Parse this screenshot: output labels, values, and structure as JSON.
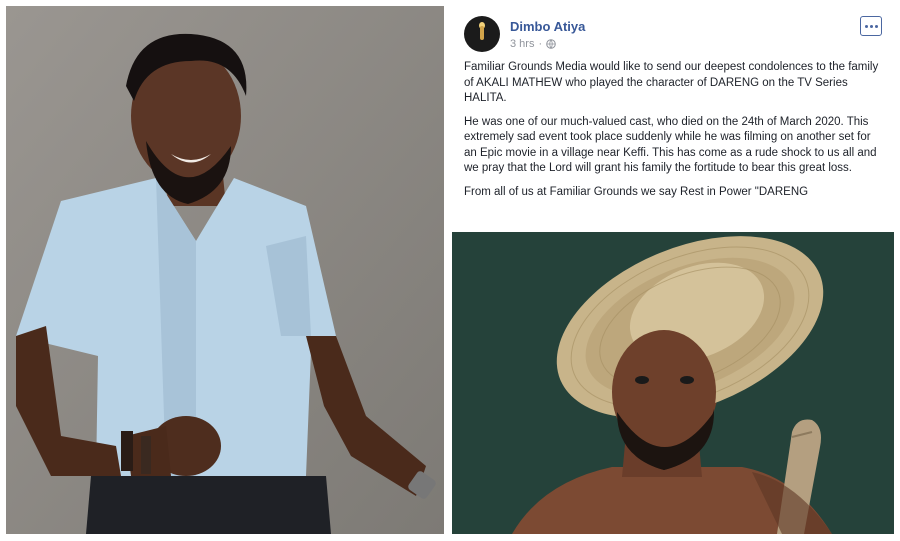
{
  "post": {
    "author": "Dimbo Atiya",
    "time": "3 hrs",
    "paragraphs": [
      "Familiar Grounds Media would like to send our deepest condolences to the family of AKALI MATHEW who played the character of DARENG on the TV Series HALITA.",
      "He was one of our much-valued cast, who died on the 24th of March 2020. This extremely sad event took place suddenly while he was filming on another set for an Epic movie in a village near Keffi. This has come as a rude shock to us all and we pray that the Lord will grant his family the fortitude to bear this great loss.",
      "From all of us at Familiar Grounds we say Rest in Power \"DARENG"
    ]
  },
  "colors": {
    "author_link": "#385898",
    "meta_text": "#90949c",
    "body_text": "#1d2129",
    "photo_background": "#25423a"
  },
  "icons": {
    "avatar": "candle-avatar",
    "privacy": "globe-icon",
    "more": "more-options-icon"
  }
}
